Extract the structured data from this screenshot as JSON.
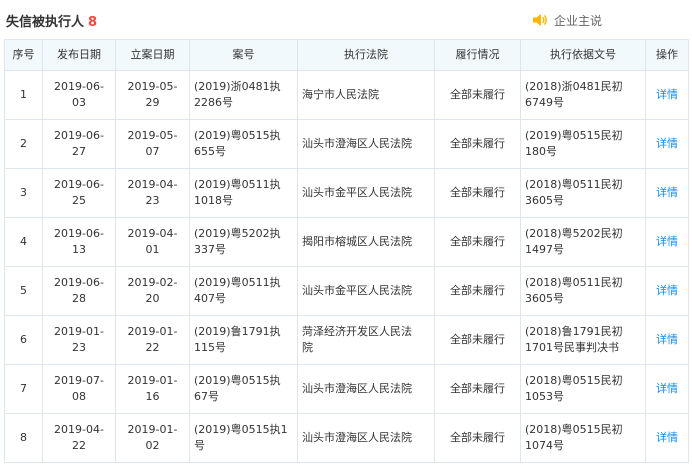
{
  "section": {
    "title": "失信被执行人",
    "count": "8"
  },
  "owner_link": {
    "icon": "speaker-icon",
    "label": "企业主说",
    "icon_color": "#ffb400"
  },
  "colors": {
    "accent": "#128bed",
    "count": "#f04a3e",
    "header_bg": "#f2f9fc",
    "border": "#dfe5ec"
  },
  "table": {
    "headers": [
      "序号",
      "发布日期",
      "立案日期",
      "案号",
      "执行法院",
      "履行情况",
      "执行依据文号",
      "操作"
    ],
    "rows": [
      [
        "1",
        "2019-06-\n03",
        "2019-05-\n29",
        "(2019)浙0481执\n2286号",
        "海宁市人民法院",
        "全部未履行",
        "(2018)浙0481民初\n6749号",
        "详情"
      ],
      [
        "2",
        "2019-06-\n27",
        "2019-05-\n07",
        "(2019)粤0515执\n655号",
        "汕头市澄海区人民法院",
        "全部未履行",
        "(2019)粤0515民初\n180号",
        "详情"
      ],
      [
        "3",
        "2019-06-\n25",
        "2019-04-\n23",
        "(2019)粤0511执\n1018号",
        "汕头市金平区人民法院",
        "全部未履行",
        "(2018)粤0511民初\n3605号",
        "详情"
      ],
      [
        "4",
        "2019-06-\n13",
        "2019-04-\n01",
        "(2019)粤5202执\n337号",
        "揭阳市榕城区人民法院",
        "全部未履行",
        "(2018)粤5202民初\n1497号",
        "详情"
      ],
      [
        "5",
        "2019-06-\n28",
        "2019-02-\n20",
        "(2019)粤0511执\n407号",
        "汕头市金平区人民法院",
        "全部未履行",
        "(2018)粤0511民初\n3605号",
        "详情"
      ],
      [
        "6",
        "2019-01-\n23",
        "2019-01-\n22",
        "(2019)鲁1791执\n115号",
        "菏泽经济开发区人民法\n院",
        "全部未履行",
        "(2018)鲁1791民初\n1701号民事判决书",
        "详情"
      ],
      [
        "7",
        "2019-07-\n08",
        "2019-01-\n16",
        "(2019)粤0515执\n67号",
        "汕头市澄海区人民法院",
        "全部未履行",
        "(2018)粤0515民初\n1053号",
        "详情"
      ],
      [
        "8",
        "2019-04-\n22",
        "2019-01-\n02",
        "(2019)粤0515执1\n号",
        "汕头市澄海区人民法院",
        "全部未履行",
        "(2018)粤0515民初\n1074号",
        "详情"
      ]
    ]
  }
}
